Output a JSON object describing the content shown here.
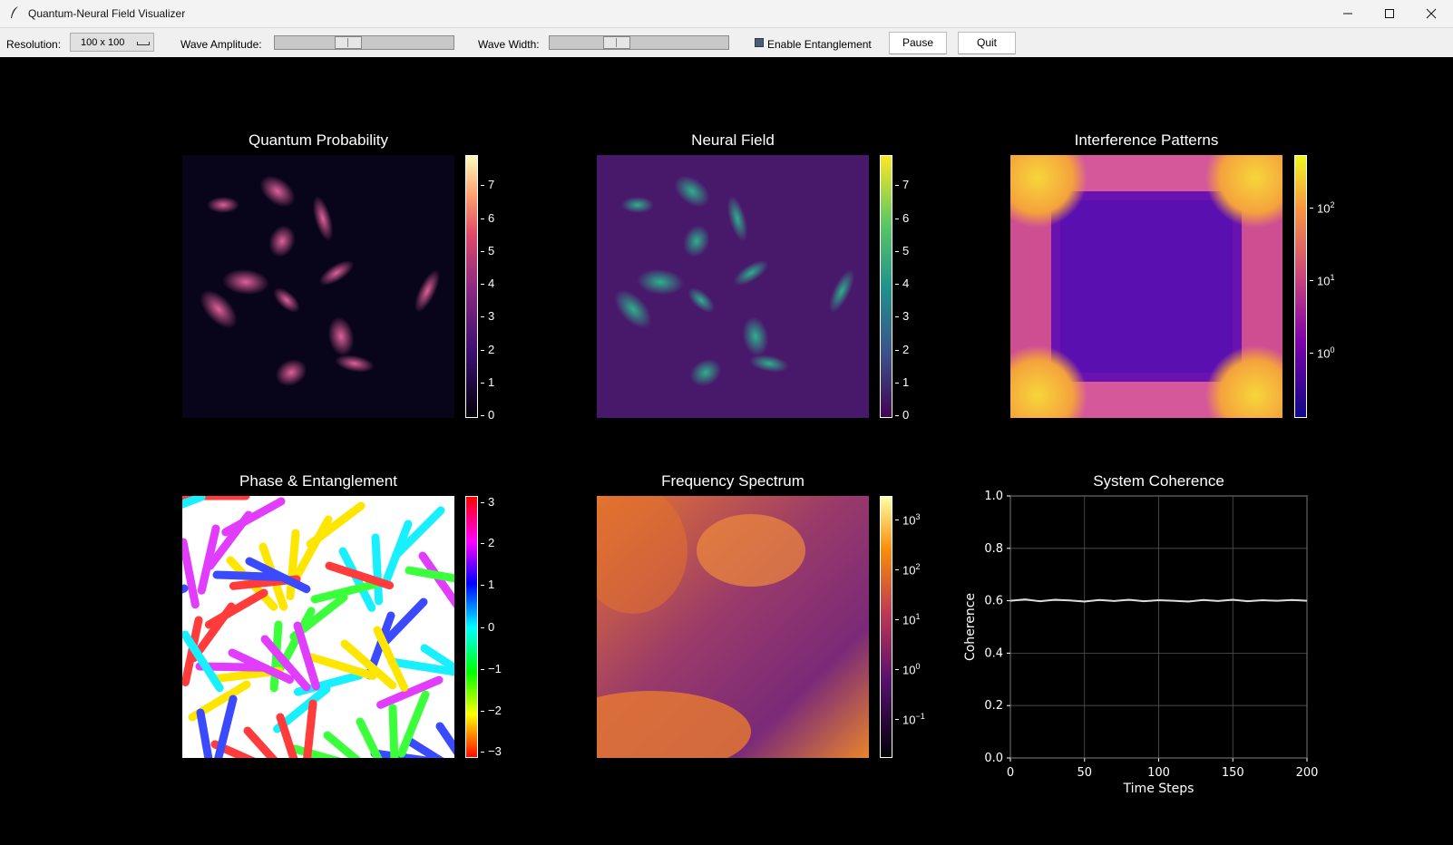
{
  "window": {
    "title": "Quantum-Neural Field Visualizer"
  },
  "toolbar": {
    "resolution_label": "Resolution:",
    "resolution_value": "100 x 100",
    "amplitude_label": "Wave Amplitude:",
    "amplitude_level": 0.39,
    "width_label": "Wave Width:",
    "width_level": 0.35,
    "entanglement_label": "Enable Entanglement",
    "entanglement_checked": true,
    "pause_label": "Pause",
    "quit_label": "Quit"
  },
  "plots": {
    "quantum": {
      "title": "Quantum Probability",
      "colormap": "magma",
      "ticks": [
        "7",
        "6",
        "5",
        "4",
        "3",
        "2",
        "1",
        "0"
      ]
    },
    "neural": {
      "title": "Neural Field",
      "colormap": "viridis",
      "ticks": [
        "7",
        "6",
        "5",
        "4",
        "3",
        "2",
        "1",
        "0"
      ]
    },
    "interference": {
      "title": "Interference Patterns",
      "colormap": "plasma",
      "ticks": [
        "10",
        "10",
        "10"
      ],
      "exponents": [
        "2",
        "1",
        "0"
      ]
    },
    "phase": {
      "title": "Phase & Entanglement",
      "colormap": "hsv",
      "ticks": [
        "3",
        "2",
        "1",
        "0",
        "−1",
        "−2",
        "−3"
      ]
    },
    "frequency": {
      "title": "Frequency Spectrum",
      "colormap": "inferno",
      "ticks": [
        "10",
        "10",
        "10",
        "10",
        "10"
      ],
      "exponents": [
        "3",
        "2",
        "1",
        "0",
        "−1"
      ]
    },
    "coherence": {
      "title": "System Coherence"
    }
  },
  "chart_data": {
    "type": "line",
    "title": "System Coherence",
    "xlabel": "Time Steps",
    "ylabel": "Coherence",
    "xlim": [
      0,
      200
    ],
    "ylim": [
      0.0,
      1.0
    ],
    "xticks": [
      "0",
      "50",
      "100",
      "150",
      "200"
    ],
    "yticks": [
      "0.0",
      "0.2",
      "0.4",
      "0.6",
      "0.8",
      "1.0"
    ],
    "grid": true,
    "series": [
      {
        "color": "#dddddd",
        "x": [
          0,
          10,
          20,
          30,
          40,
          50,
          60,
          70,
          80,
          90,
          100,
          110,
          120,
          130,
          140,
          150,
          160,
          170,
          180,
          190,
          200
        ],
        "values": [
          0.6,
          0.605,
          0.598,
          0.604,
          0.601,
          0.597,
          0.603,
          0.599,
          0.604,
          0.598,
          0.602,
          0.6,
          0.597,
          0.603,
          0.599,
          0.604,
          0.598,
          0.602,
          0.6,
          0.603,
          0.6
        ]
      }
    ]
  },
  "colors": {
    "background": "#000000",
    "toolbar": "#f0f0f0"
  }
}
